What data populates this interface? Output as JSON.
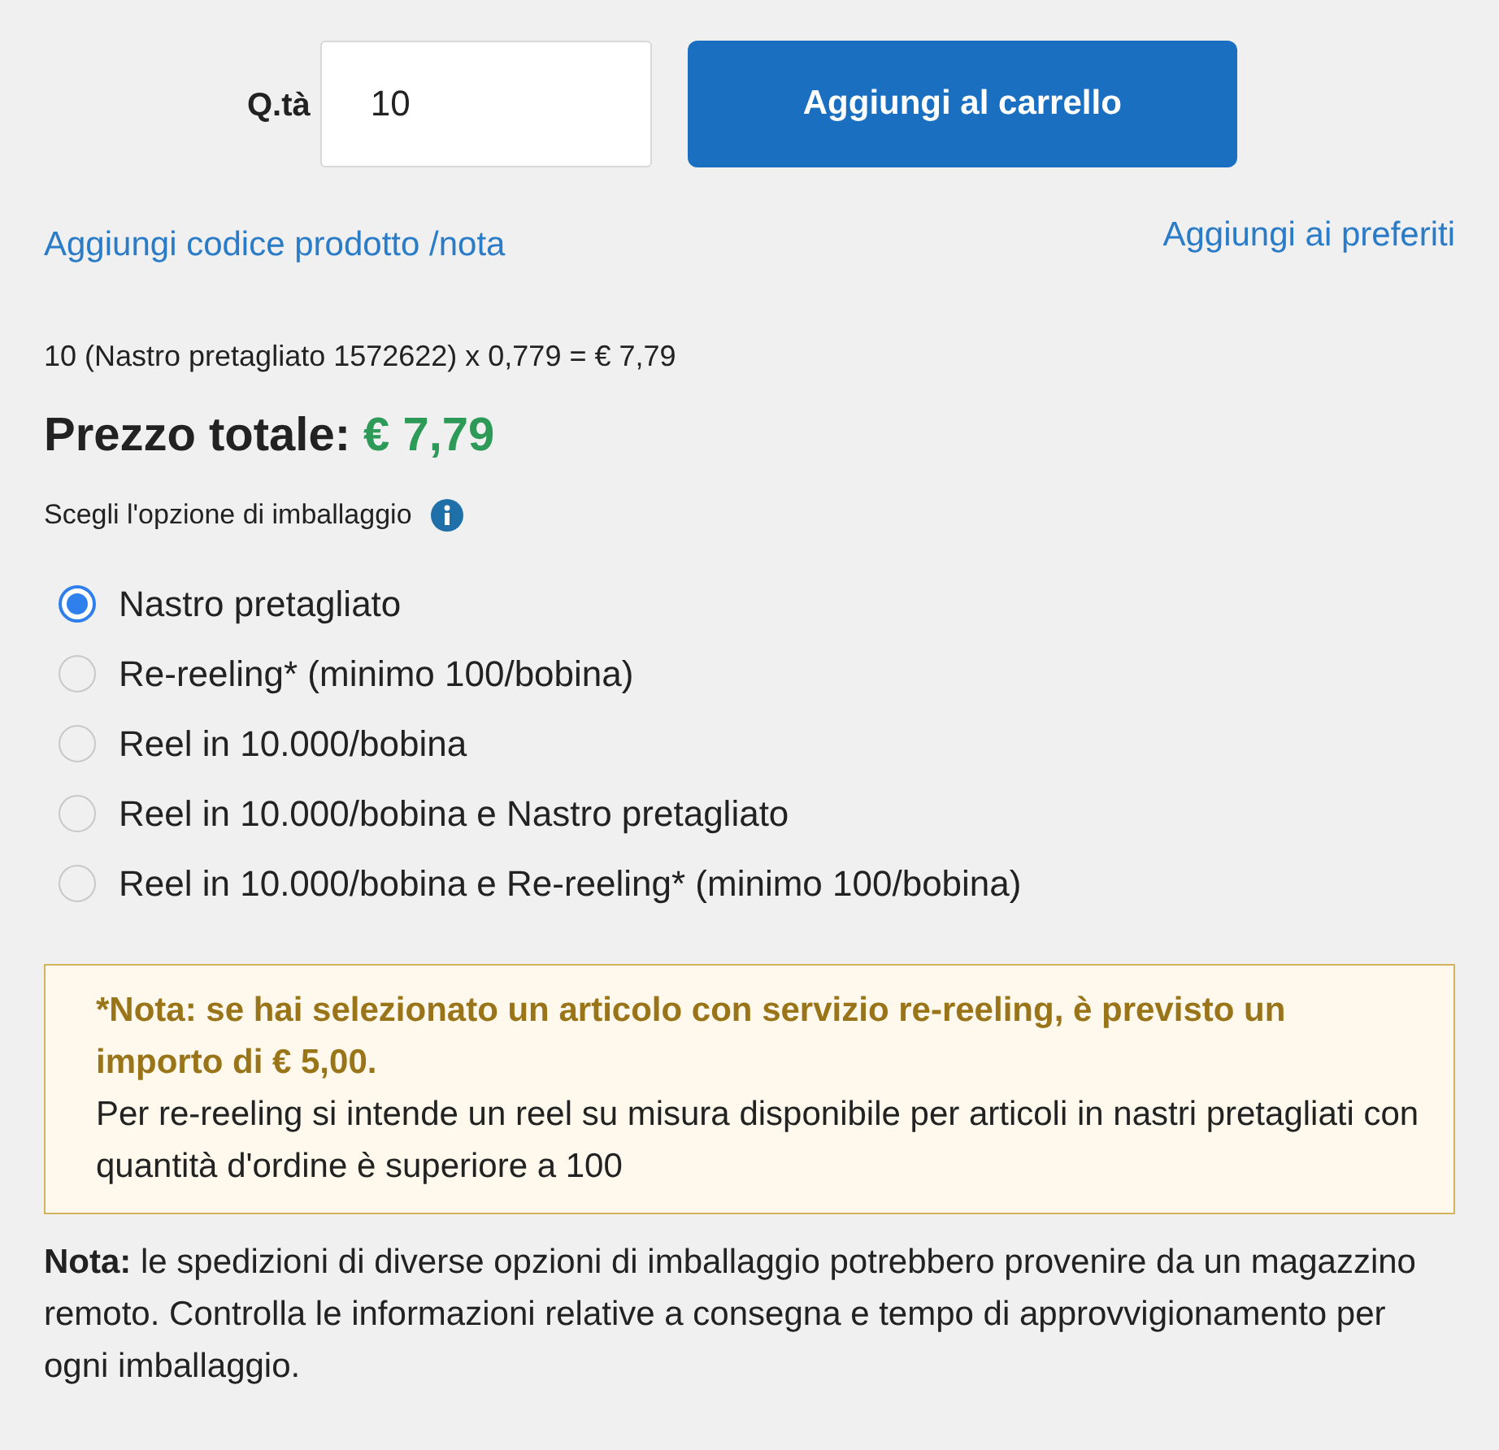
{
  "quantity": {
    "label": "Q.tà",
    "value": "10"
  },
  "add_to_cart_button": "Aggiungi al carrello",
  "links": {
    "product_code": "Aggiungi codice prodotto /nota",
    "favorites": "Aggiungi ai preferiti"
  },
  "calculation": "10 (Nastro pretagliato 1572622) x 0,779 = € 7,79",
  "total": {
    "label": "Prezzo totale:",
    "value": "€ 7,79"
  },
  "packaging": {
    "label": "Scegli l'opzione di imballaggio",
    "options": [
      {
        "label": "Nastro pretagliato",
        "selected": true
      },
      {
        "label": "Re-reeling* (minimo 100/bobina)",
        "selected": false
      },
      {
        "label": "Reel in 10.000/bobina",
        "selected": false
      },
      {
        "label": "Reel in 10.000/bobina e Nastro pretagliato",
        "selected": false
      },
      {
        "label": "Reel in 10.000/bobina e Re-reeling* (minimo 100/bobina)",
        "selected": false
      }
    ]
  },
  "notice": {
    "title": "*Nota: se hai selezionato un articolo con servizio re-reeling, è previsto un importo di € 5,00.",
    "body": "Per re-reeling si intende un reel su misura disponibile per articoli in nastri pretagliati con quantità d'ordine è superiore a 100"
  },
  "footnote": "**Nota:** le spedizioni di diverse opzioni di imballaggio potrebbero provenire da un magazzino remoto. Controlla le informazioni relative a consegna e tempo di approvvigionamento per ogni imballaggio."
}
